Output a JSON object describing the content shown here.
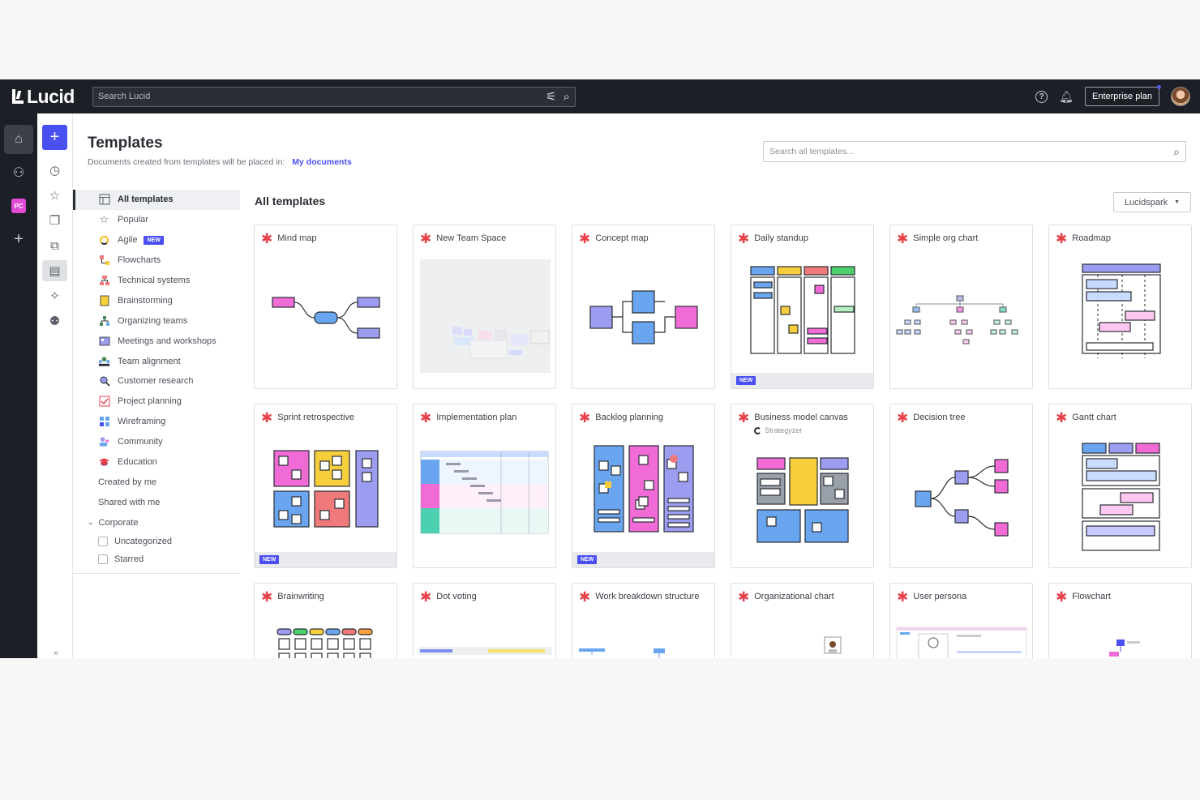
{
  "topbar": {
    "logo_text": "Lucid",
    "search_placeholder": "Search Lucid",
    "filter_icon": "sliders-icon",
    "search_icon": "search-icon",
    "help_icon": "help-icon",
    "bell_icon": "bell-icon",
    "plan_label": "Enterprise plan"
  },
  "rail": {
    "items": [
      "home-icon",
      "team-icon",
      "pc-badge",
      "add-icon"
    ],
    "pc_badge_text": "PC"
  },
  "col2": {
    "items": [
      "clock-icon",
      "star-icon",
      "documents-icon",
      "shared-icon",
      "templates-icon",
      "integrations-icon",
      "people-icon"
    ]
  },
  "header": {
    "title": "Templates",
    "subtitle": "Documents created from templates will be placed in:",
    "location_link": "My documents",
    "search_placeholder": "Search all templates..."
  },
  "categories": [
    {
      "label": "All templates",
      "icon": "layout-icon",
      "active": true
    },
    {
      "label": "Popular",
      "icon": "star-outline-icon"
    },
    {
      "label": "Agile",
      "icon": "agile-icon",
      "badge": "NEW"
    },
    {
      "label": "Flowcharts",
      "icon": "flowchart-icon"
    },
    {
      "label": "Technical systems",
      "icon": "network-icon"
    },
    {
      "label": "Brainstorming",
      "icon": "sticky-note-icon"
    },
    {
      "label": "Organizing teams",
      "icon": "org-icon"
    },
    {
      "label": "Meetings and workshops",
      "icon": "meeting-icon"
    },
    {
      "label": "Team alignment",
      "icon": "team-alignment-icon"
    },
    {
      "label": "Customer research",
      "icon": "magnifier-icon"
    },
    {
      "label": "Project planning",
      "icon": "checklist-icon"
    },
    {
      "label": "Wireframing",
      "icon": "wireframe-icon"
    },
    {
      "label": "Community",
      "icon": "community-icon"
    },
    {
      "label": "Education",
      "icon": "graduation-icon"
    }
  ],
  "category_links": [
    "Created by me",
    "Shared with me"
  ],
  "corporate": {
    "label": "Corporate",
    "folders": [
      "Uncategorized",
      "Starred"
    ]
  },
  "main": {
    "section_title": "All templates",
    "filter_label": "Lucidspark"
  },
  "new_badge": "NEW",
  "templates": [
    {
      "title": "Mind map",
      "thumb": "mindmap"
    },
    {
      "title": "New Team Space",
      "thumb": "teamspace"
    },
    {
      "title": "Concept map",
      "thumb": "concept"
    },
    {
      "title": "Daily standup",
      "thumb": "standup",
      "new": true
    },
    {
      "title": "Simple org chart",
      "thumb": "orgchart"
    },
    {
      "title": "Roadmap",
      "thumb": "roadmap"
    },
    {
      "title": "Sprint retrospective",
      "thumb": "retro",
      "new": true
    },
    {
      "title": "Implementation plan",
      "thumb": "implementation"
    },
    {
      "title": "Backlog planning",
      "thumb": "backlog",
      "new": true
    },
    {
      "title": "Business model canvas",
      "subtitle": "Strategyzer",
      "thumb": "bmc"
    },
    {
      "title": "Decision tree",
      "thumb": "decision"
    },
    {
      "title": "Gantt chart",
      "thumb": "gantt"
    },
    {
      "title": "Brainwriting",
      "thumb": "brainwriting"
    },
    {
      "title": "Dot voting",
      "thumb": "dotvoting"
    },
    {
      "title": "Work breakdown structure",
      "thumb": "wbs"
    },
    {
      "title": "Organizational chart",
      "thumb": "orgchart2"
    },
    {
      "title": "User persona",
      "thumb": "persona"
    },
    {
      "title": "Flowchart",
      "thumb": "flowchart"
    }
  ],
  "colors": {
    "accent": "#4a4ff0",
    "pink": "#f06bd6",
    "purple": "#9c9cf0",
    "blue": "#6aa6f0",
    "yellow": "#f7cf3c",
    "red": "#f07a7a",
    "green": "#4cd06b",
    "brand_star": "#e8414a"
  }
}
